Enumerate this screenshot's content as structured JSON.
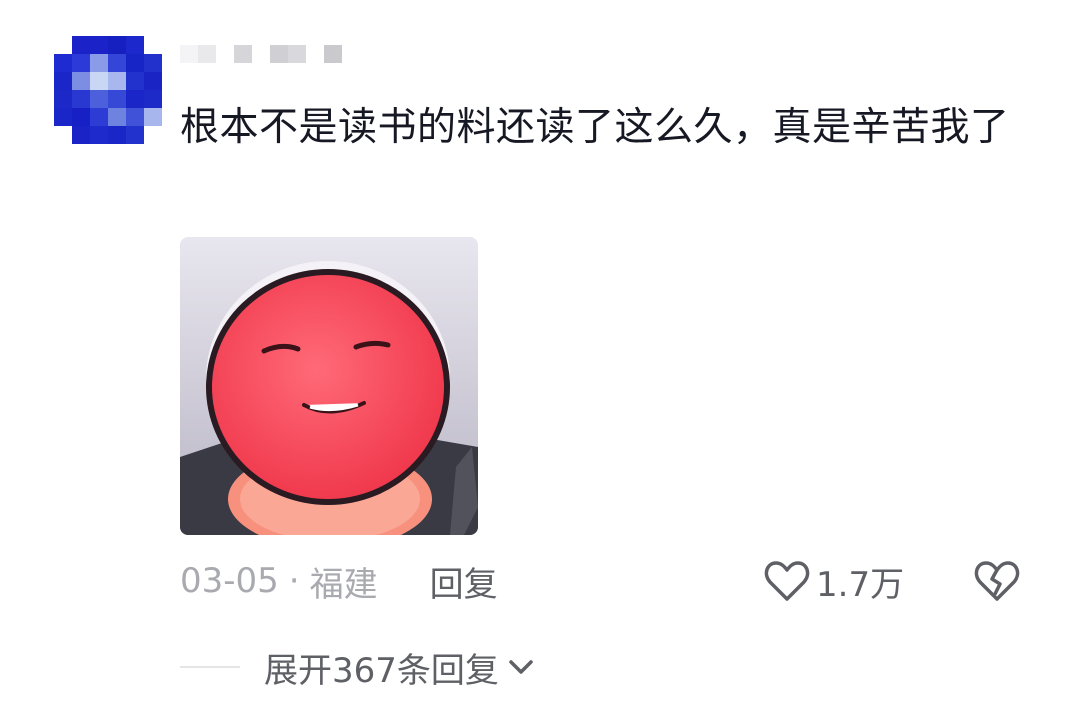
{
  "comment": {
    "text": "根本不是读书的料还读了这么久，真是辛苦我了",
    "date": "03-05",
    "separator": "·",
    "location": "福建",
    "reply_label": "回复",
    "like_count": "1.7万",
    "expand_label": "展开367条回复"
  },
  "icons": {
    "like": "heart-outline-icon",
    "dislike": "broken-heart-icon",
    "expand": "chevron-down-icon"
  },
  "colors": {
    "text": "#161823",
    "secondary": "#a9aab0",
    "action": "#5e6066"
  }
}
